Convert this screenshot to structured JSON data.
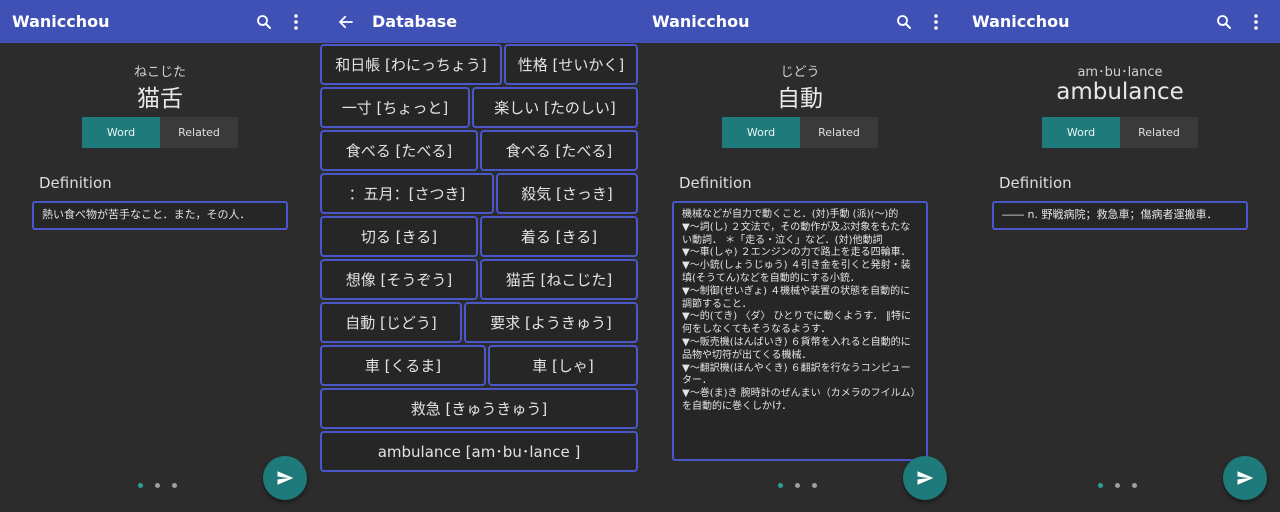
{
  "panels": {
    "p1": {
      "app_title": "Wanicchou",
      "reading": "ねこじた",
      "word": "猫舌",
      "tabs": [
        "Word",
        "Related"
      ],
      "definition_label": "Definition",
      "definition": "熱い食べ物が苦手なこと．また，その人．"
    },
    "p2": {
      "title": "Database",
      "rows": [
        [
          "和日帳 [わにっちょう]",
          "性格 [せいかく]"
        ],
        [
          "一寸 [ちょっと]",
          "楽しい [たのしい]"
        ],
        [
          "食べる [たべる]",
          "食べる [たべる]"
        ],
        [
          "：五月：[さつき]",
          "殺気 [さっき]"
        ],
        [
          "切る [きる]",
          "着る [きる]"
        ],
        [
          "想像 [そうぞう]",
          "猫舌 [ねこじた]"
        ],
        [
          "自動 [じどう]",
          "要求 [ようきゅう]"
        ],
        [
          "車 [くるま]",
          "車 [しゃ]"
        ],
        [
          "救急 [きゅうきゅう]"
        ],
        [
          "ambulance  [am･bu･lance ]"
        ]
      ]
    },
    "p3": {
      "app_title": "Wanicchou",
      "reading": "じどう",
      "word": "自動",
      "tabs": [
        "Word",
        "Related"
      ],
      "definition_label": "Definition",
      "definition": "機械などが自力で動くこと．(対)手動 (派)(〜)的\n▼〜詞(し) ２文法で，その動作が及ぶ対象をもたない動詞． ＊「走る・泣く」など．(対)他動詞\n▼〜車(しゃ) ２エンジンの力で路上を走る四輪車．\n▼〜小銃(しょうじゅう) ４引き金を引くと発射・装填(そうてん)などを自動的にする小銃．\n▼〜制御(せいぎょ) ４機械や装置の状態を自動的に調節すること．\n▼〜的(てき) 〈ダ〉 ひとりでに動くようす． ∥特に何をしなくてもそうなるようす．\n▼〜販売機(はんばいき) ６貨幣を入れると自動的に品物や切符が出てくる機械．\n▼〜翻訳機(ほんやくき) ６翻訳を行なうコンピューター．\n▼〜巻(ま)き 腕時計のぜんまい（カメラのフイルム）を自動的に巻くしかけ．"
    },
    "p4": {
      "app_title": "Wanicchou",
      "reading": "am･bu･lance",
      "word": "ambulance",
      "tabs": [
        "Word",
        "Related"
      ],
      "definition_label": "Definition",
      "definition": "―― n.  野戦病院；救急車；傷病者運搬車．"
    }
  },
  "colors": {
    "appbar": "#3f51b5",
    "accent_teal": "#1f7b7b",
    "box_border": "#4a57c9",
    "background": "#2c2c2c"
  },
  "icons": {
    "search": "search-icon",
    "more": "more-vert-icon",
    "back": "arrow-back-icon",
    "send": "send-icon"
  }
}
